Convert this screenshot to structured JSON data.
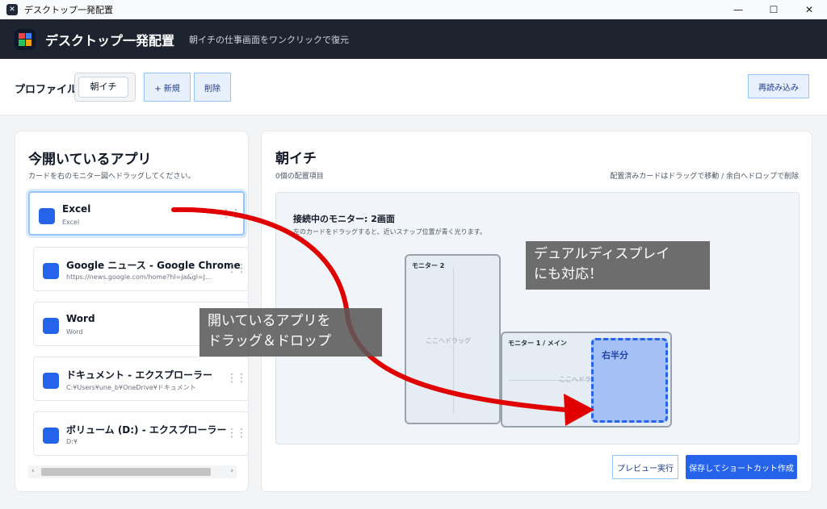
{
  "window": {
    "title": "デスクトップ一発配置",
    "minimize": "—",
    "maximize": "☐",
    "close": "✕"
  },
  "header": {
    "title": "デスクトップ一発配置",
    "subtitle": "朝イチの仕事画面をワンクリックで復元",
    "logo_colors": [
      "#ef4444",
      "#3b82f6",
      "#22c55e",
      "#f59e0b"
    ]
  },
  "profile": {
    "label": "プロファイル",
    "selected": "朝イチ",
    "new_button": "+ 新規",
    "delete_button": "削除",
    "reload_button": "再読み込み"
  },
  "open_apps": {
    "title": "今開いているアプリ",
    "subtitle": "カードを右のモニター図へドラッグしてください。",
    "items": [
      {
        "name": "Excel",
        "path": "Excel"
      },
      {
        "name": "Google ニュース - Google Chrome",
        "path": "https://news.google.com/home?hl=ja&gl=J..."
      },
      {
        "name": "Word",
        "path": "Word"
      },
      {
        "name": "ドキュメント - エクスプローラー",
        "path": "C:¥Users¥une_b¥OneDrive¥ドキュメント"
      },
      {
        "name": "ボリューム (D:) - エクスプローラー",
        "path": "D:¥"
      }
    ],
    "grip": "⋮⋮",
    "scroll_left": "‹",
    "scroll_right": "›"
  },
  "layout": {
    "title": "朝イチ",
    "count": "0個の配置項目",
    "hint": "配置済みカードはドラッグで移動 / 余白へドロップで削除",
    "stage_title": "接続中のモニター: 2画面",
    "stage_subtitle": "左のカードをドラッグすると、近いスナップ位置が青く光ります。",
    "monitor2_label": "モニター 2",
    "monitor1_label": "モニター 1 / メイン",
    "drop_text": "ここへドラッグ",
    "snap_label": "右半分",
    "preview_button": "プレビュー実行",
    "save_button": "保存してショートカット作成"
  },
  "annotations": {
    "drag_callout": "開いているアプリを\nドラッグ＆ドロップ",
    "dual_callout": "デュアルディスプレイ\nにも対応！",
    "arrow_color": "#e00000"
  },
  "colors": {
    "accent": "#2563eb",
    "header_bg": "#1e2330"
  }
}
